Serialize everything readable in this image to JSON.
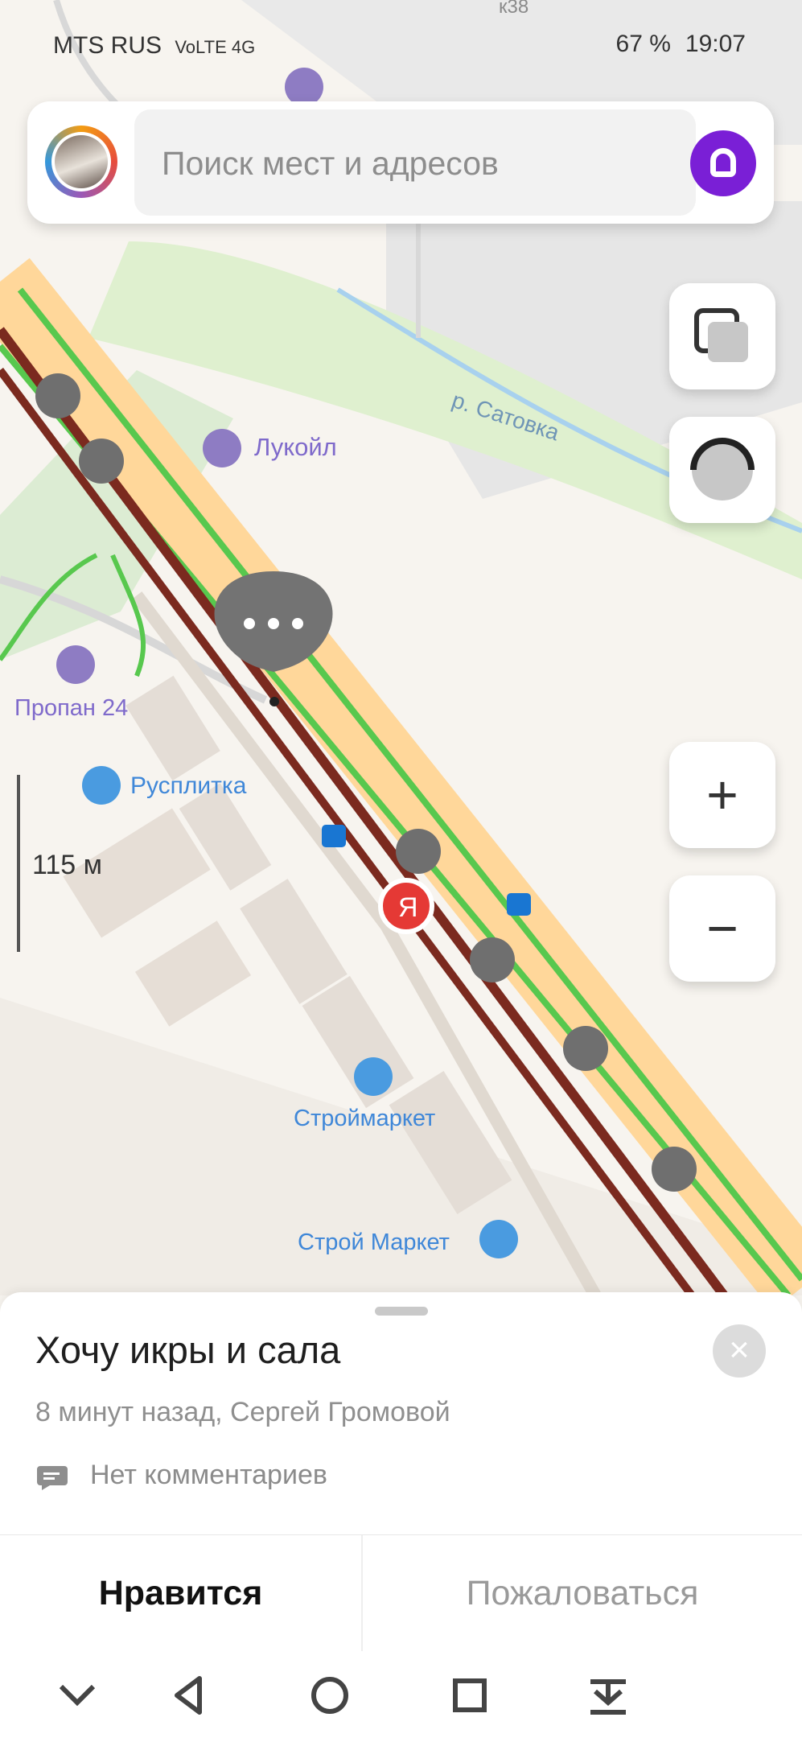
{
  "status_bar": {
    "carrier": "MTS RUS",
    "network": "VoLTE 4G",
    "battery": "67 %",
    "time": "19:07"
  },
  "search": {
    "placeholder": "Поиск мест и адресов",
    "alice_icon": "alice-icon"
  },
  "map": {
    "labels": {
      "river": "р. Сатовка",
      "gas_station": "Лукойл",
      "propane": "Пропан 24",
      "shop_rusplitka": "Русплитка",
      "scale": "115 м",
      "shop_stroymarket": "Строймаркет",
      "shop_stroy_market": "Строй Маркет",
      "top_label": "к38",
      "yandex": "Я"
    },
    "controls": {
      "layers_icon": "layers-icon",
      "location_icon": "location-icon",
      "zoom_in": "+",
      "zoom_out": "−"
    },
    "colors": {
      "traffic_heavy": "#7b2a1f",
      "traffic_medium": "#ffd18a",
      "traffic_green": "#58c84e",
      "alice": "#7a1fd6",
      "pin_red": "#e53935"
    }
  },
  "event_card": {
    "title": "Хочу икры и сала",
    "meta": "8 минут назад, Сергей Громовой",
    "comments": "Нет комментариев",
    "close_icon": "close-icon"
  },
  "actions": {
    "like": "Нравится",
    "report": "Пожаловаться"
  },
  "navigation": {
    "icons": [
      "chevron-down-icon",
      "back-icon",
      "home-icon",
      "recents-icon",
      "download-icon"
    ]
  }
}
